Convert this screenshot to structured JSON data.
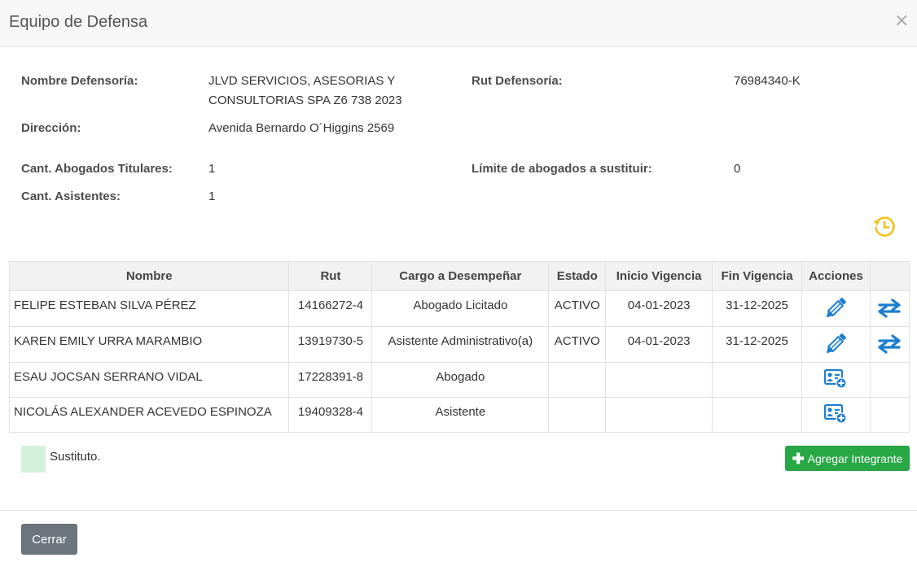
{
  "modal": {
    "title": "Equipo de Defensa",
    "close_symbol": "×"
  },
  "info": {
    "nombre_defensoria": {
      "label": "Nombre Defensoría:",
      "value_line1": "JLVD SERVICIOS, ASESORIAS Y",
      "value_line2": "CONSULTORIAS SPA Z6 738 2023"
    },
    "rut_defensoria": {
      "label": "Rut Defensoría:",
      "value": "76984340-K"
    },
    "direccion": {
      "label": "Dirección:",
      "value": "Avenida Bernardo O´Higgins 2569"
    },
    "cant_titulares": {
      "label": "Cant. Abogados Titulares:",
      "value": "1"
    },
    "limite": {
      "label": "Límite de abogados a sustituir:",
      "value": "0"
    },
    "cant_asistentes": {
      "label": "Cant. Asistentes:",
      "value": "1"
    }
  },
  "table": {
    "headers": [
      "Nombre",
      "Rut",
      "Cargo a Desempeñar",
      "Estado",
      "Inicio Vigencia",
      "Fin Vigencia",
      "Acciones",
      ""
    ],
    "rows": [
      {
        "nombre": "FELIPE ESTEBAN SILVA PÉREZ",
        "rut": "14166272-4",
        "cargo": "Abogado Licitado",
        "estado": "ACTIVO",
        "inicio": "04-01-2023",
        "fin": "31-12-2025",
        "actions": [
          "pencil-icon",
          "swap-arrows-icon"
        ]
      },
      {
        "nombre": "KAREN EMILY URRA MARAMBIO",
        "rut": "13919730-5",
        "cargo": "Asistente Administrativo(a)",
        "estado": "ACTIVO",
        "inicio": "04-01-2023",
        "fin": "31-12-2025",
        "actions": [
          "pencil-icon",
          "swap-arrows-icon"
        ]
      },
      {
        "nombre": "ESAU JOCSAN SERRANO VIDAL",
        "rut": "17228391-8",
        "cargo": "Abogado",
        "estado": "",
        "inicio": "",
        "fin": "",
        "actions": [
          "add-user-card-icon"
        ]
      },
      {
        "nombre": "NICOLÁS ALEXANDER ACEVEDO ESPINOZA",
        "rut": "19409328-4",
        "cargo": "Asistente",
        "estado": "",
        "inicio": "",
        "fin": "",
        "actions": [
          "add-user-card-icon"
        ]
      }
    ]
  },
  "legend": {
    "label": "Sustituto.",
    "swatch_color": "#d4f2da"
  },
  "buttons": {
    "add_member": "Agregar Integrante",
    "close": "Cerrar"
  },
  "icons": {
    "history": "history-clock-icon"
  },
  "colors": {
    "action_blue": "#1b7ed1",
    "history_yellow": "#f2c01b",
    "success_green": "#28a745",
    "secondary_gray": "#6c757d"
  }
}
